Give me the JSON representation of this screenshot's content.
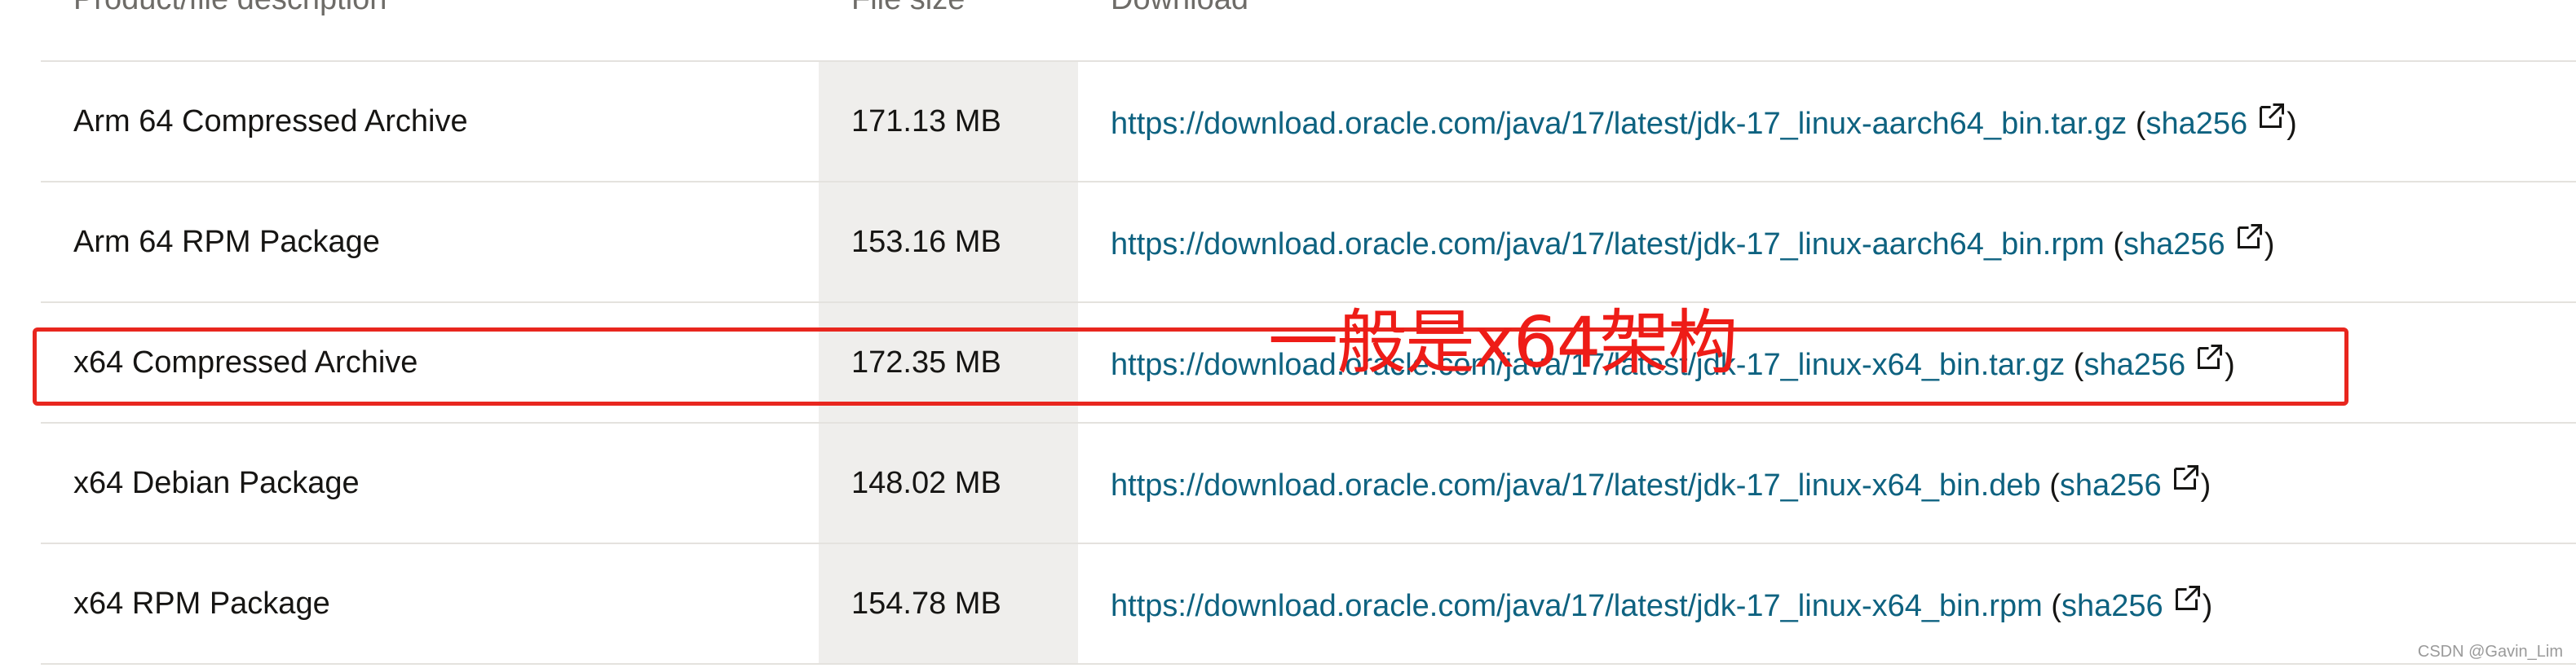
{
  "table": {
    "headers": {
      "description": "Product/file description",
      "size": "File size",
      "download": "Download"
    },
    "rows": [
      {
        "description": "Arm 64 Compressed Archive",
        "size": "171.13 MB",
        "url": "https://download.oracle.com/java/17/latest/jdk-17_linux-aarch64_bin.tar.gz",
        "checksum": "sha256"
      },
      {
        "description": "Arm 64 RPM Package",
        "size": "153.16 MB",
        "url": "https://download.oracle.com/java/17/latest/jdk-17_linux-aarch64_bin.rpm",
        "checksum": "sha256"
      },
      {
        "description": "x64 Compressed Archive",
        "size": "172.35 MB",
        "url": "https://download.oracle.com/java/17/latest/jdk-17_linux-x64_bin.tar.gz",
        "checksum": "sha256"
      },
      {
        "description": "x64 Debian Package",
        "size": "148.02 MB",
        "url": "https://download.oracle.com/java/17/latest/jdk-17_linux-x64_bin.deb",
        "checksum": "sha256"
      },
      {
        "description": "x64 RPM Package",
        "size": "154.78 MB",
        "url": "https://download.oracle.com/java/17/latest/jdk-17_linux-x64_bin.rpm",
        "checksum": "sha256"
      }
    ]
  },
  "annotation": {
    "text": "一般是x64架构",
    "color": "#ee1c17"
  },
  "watermark": "CSDN @Gavin_Lim",
  "icons": {
    "external_link": "external-link-icon"
  },
  "colors": {
    "link": "#0e6280",
    "size_column_bg": "#efeeec",
    "highlight_border": "#e8261e"
  }
}
